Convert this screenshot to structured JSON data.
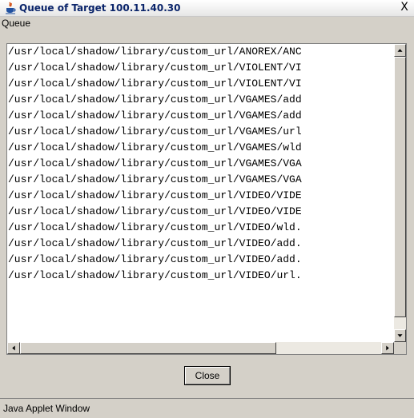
{
  "window": {
    "title": "Queue of Target 100.11.40.30",
    "close_glyph": "X",
    "title_icon": "java-icon"
  },
  "queue_label": "Queue",
  "queue_items": [
    "/usr/local/shadow/library/custom_url/ANOREX/ANC",
    "/usr/local/shadow/library/custom_url/VIOLENT/VI",
    "/usr/local/shadow/library/custom_url/VIOLENT/VI",
    "/usr/local/shadow/library/custom_url/VGAMES/add",
    "/usr/local/shadow/library/custom_url/VGAMES/add",
    "/usr/local/shadow/library/custom_url/VGAMES/url",
    "/usr/local/shadow/library/custom_url/VGAMES/wld",
    "/usr/local/shadow/library/custom_url/VGAMES/VGA",
    "/usr/local/shadow/library/custom_url/VGAMES/VGA",
    "/usr/local/shadow/library/custom_url/VIDEO/VIDE",
    "/usr/local/shadow/library/custom_url/VIDEO/VIDE",
    "/usr/local/shadow/library/custom_url/VIDEO/wld.",
    "/usr/local/shadow/library/custom_url/VIDEO/add.",
    "/usr/local/shadow/library/custom_url/VIDEO/add.",
    "/usr/local/shadow/library/custom_url/VIDEO/url."
  ],
  "buttons": {
    "close_label": "Close"
  },
  "status": {
    "text": "Java Applet Window"
  },
  "colors": {
    "title_text": "#0a246a",
    "panel_bg": "#d4d0c8",
    "list_bg": "#ffffff"
  }
}
